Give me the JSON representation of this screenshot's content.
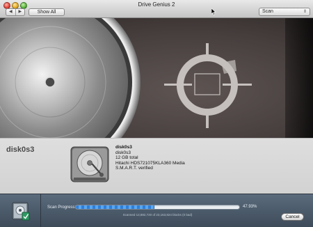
{
  "window": {
    "title": "Drive Genius 2"
  },
  "toolbar": {
    "back_glyph": "◀",
    "forward_glyph": "▶",
    "show_all_label": "Show All",
    "mode_popup_value": "Scan",
    "mode_popup_chevron": "⇕"
  },
  "disk": {
    "heading": "disk0s3",
    "details": {
      "name": "disk0s3",
      "id": "disk0s3",
      "size": "12 GB total",
      "model": "Hitachi HDS721075KLA360 Media",
      "smart": "S.M.A.R.T. verified"
    }
  },
  "scan": {
    "label": "Scan Progress:",
    "fraction": 0.4793,
    "percent_text": "47.93%",
    "detail_text": "Scanned 13,882,720 of 23,163,824 blocks (0 bad)",
    "cancel_label": "Cancel"
  },
  "colors": {
    "progress_blue": "#2f7fd8",
    "status_bar": "#4a5a6a",
    "banner_bg": "#473f3e"
  },
  "icons": [
    "close-icon",
    "minimize-icon",
    "zoom-icon",
    "back-arrow-icon",
    "forward-arrow-icon",
    "chevron-updown-icon",
    "hard-drive-icon",
    "scan-status-icon",
    "cursor-icon"
  ]
}
